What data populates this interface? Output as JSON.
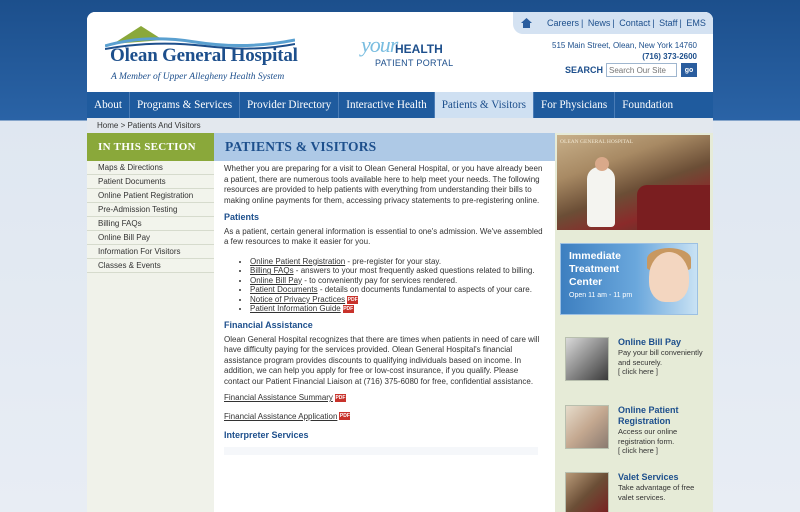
{
  "header": {
    "logo_title": "Olean General Hospital",
    "logo_subtitle": "A Member of Upper Allegheny Health System",
    "portal_your": "your",
    "portal_health": "HEALTH",
    "portal_subtitle": "PATIENT PORTAL",
    "util_links": [
      "Careers",
      "News",
      "Contact",
      "Staff",
      "EMS"
    ],
    "address": "515 Main Street, Olean, New York 14760",
    "phone": "(716) 373-2600",
    "search_label": "SEARCH",
    "search_placeholder": "Search Our Site",
    "go_label": "go"
  },
  "nav": {
    "items": [
      "About",
      "Programs & Services",
      "Provider Directory",
      "Interactive Health",
      "Patients & Visitors",
      "For Physicians",
      "Foundation"
    ],
    "active_index": 4
  },
  "breadcrumb": "Home > Patients And Visitors",
  "sidebar": {
    "heading": "IN THIS SECTION",
    "items": [
      "Maps & Directions",
      "Patient Documents",
      "Online Patient Registration",
      "Pre-Admission Testing",
      "Billing FAQs",
      "Online Bill Pay",
      "Information For Visitors",
      "Classes & Events"
    ]
  },
  "main": {
    "heading": "PATIENTS & VISITORS",
    "intro": "Whether you are preparing for a visit to Olean General Hospital, or you have already been a patient, there are numerous tools available here to help meet your needs. The following resources are provided to help patients with everything from understanding their bills to making online payments for them, accessing privacy statements to pre-registering online.",
    "patients_heading": "Patients",
    "patients_text": "As a patient, certain general information is essential to one's admission. We've assembled a few resources to make it easier for you.",
    "list": [
      {
        "link": "Online Patient Registration",
        "text": " - pre-register for your stay."
      },
      {
        "link": "Billing FAQs",
        "text": " - answers to your most frequently asked questions related to billing."
      },
      {
        "link": "Online Bill Pay",
        "text": " - to conveniently pay for services rendered."
      },
      {
        "link": "Patient Documents",
        "text": " - details on documents fundamental to aspects of your care."
      },
      {
        "link": "Notice of Privacy Practices",
        "text": ""
      },
      {
        "link": "Patient Information Guide",
        "text": ""
      }
    ],
    "fa_heading": "Financial Assistance",
    "fa_text": "Olean General Hospital recognizes that there are times when patients in need of care will have difficulty paying for the services provided. Olean General Hospital's financial assistance program provides discounts to qualifying individuals based on income. In addition, we can help you apply for free or low-cost insurance, if you qualify. Please contact our Patient Financial Liaison at (716) 375-6080 for free, confidential assistance.",
    "fa_summary": "Financial Assistance Summary",
    "fa_application": "Financial Assistance Application",
    "interp_heading": "Interpreter Services",
    "pdf_label": "PDF"
  },
  "right": {
    "photo_sign": "OLEAN GENERAL HOSPITAL",
    "itc_title": "Immediate Treatment Center",
    "itc_hours": "Open 11 am - 11 pm",
    "promos": [
      {
        "title": "Online Bill Pay",
        "text": "Pay your bill conveniently and securely.",
        "link": "[ click here ]"
      },
      {
        "title": "Online Patient Registration",
        "text": "Access our online registration form.",
        "link": "[ click here ]"
      },
      {
        "title": "Valet Services",
        "text": "Take advantage of free valet services.",
        "link": ""
      }
    ]
  },
  "colors": {
    "brand_blue": "#1d4f8c",
    "nav_blue": "#1f5b9e",
    "section_green": "#8aa83a",
    "heading_blue_bg": "#aec9e6"
  }
}
